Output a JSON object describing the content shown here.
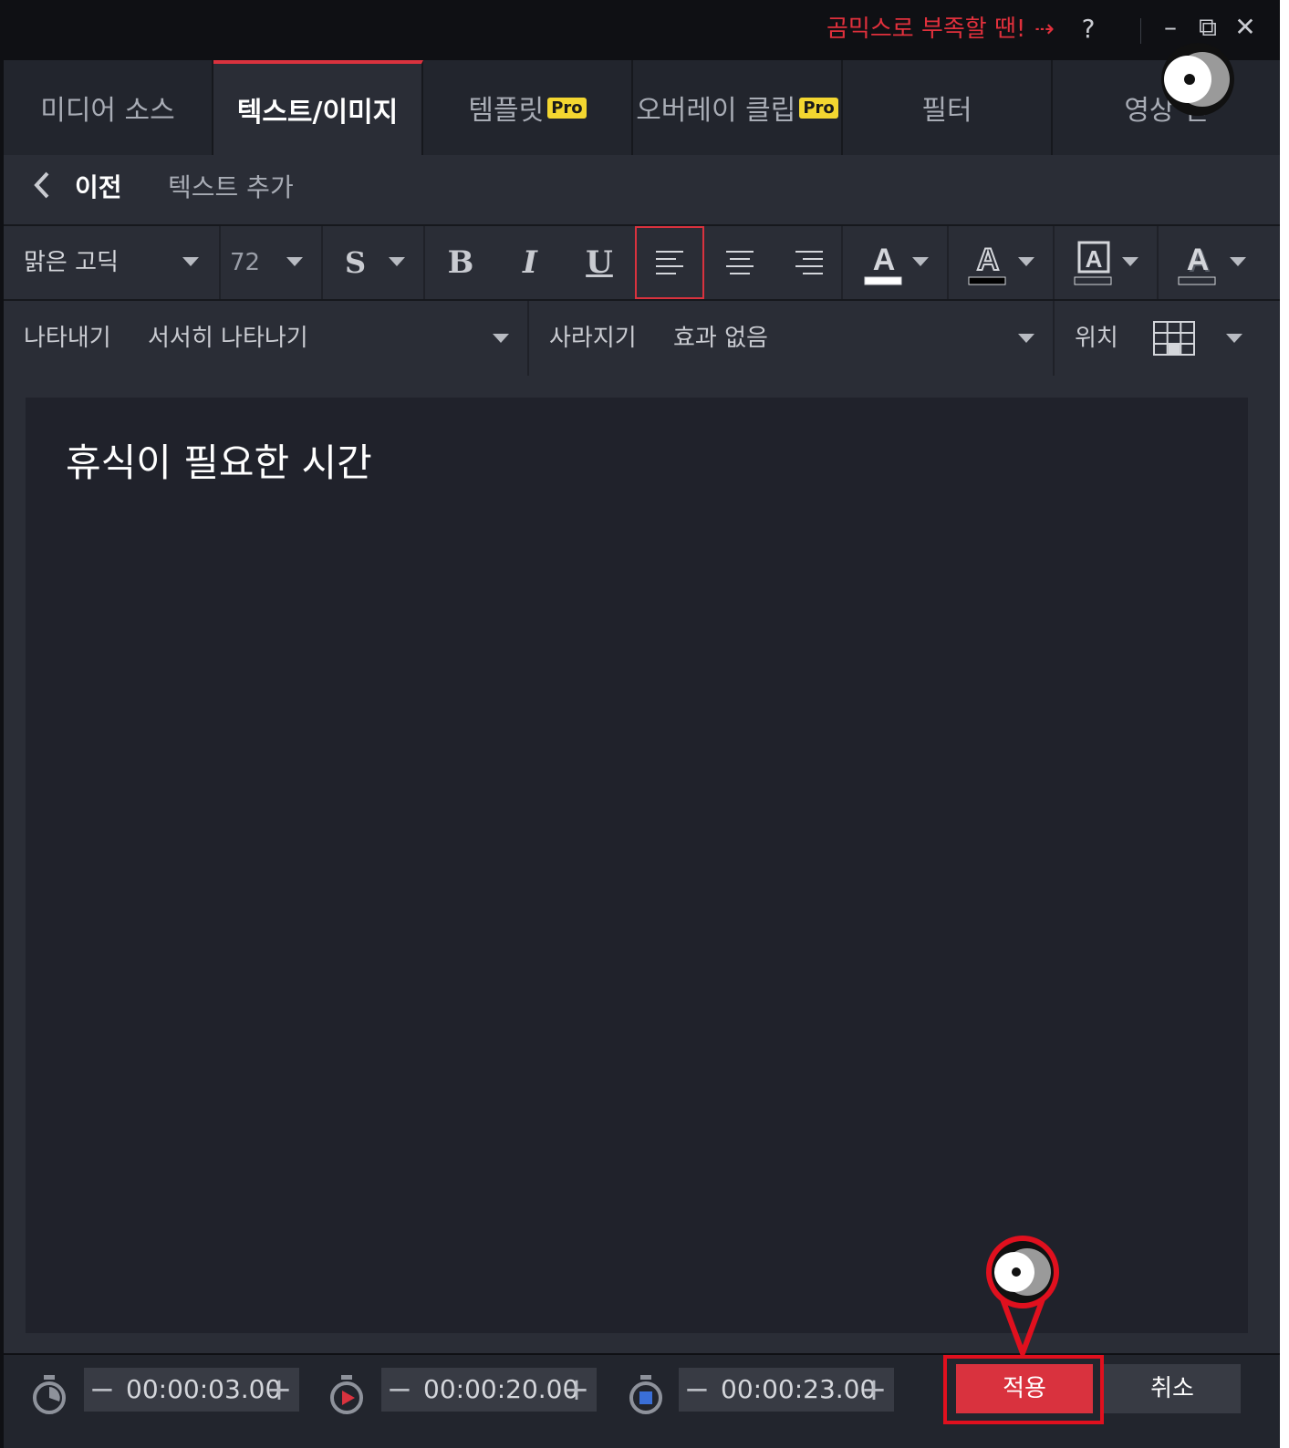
{
  "titlebar": {
    "promo_text": "곰믹스로 부족할 땐!",
    "promo_arrow": "⇢",
    "help_label": "?",
    "minimize_label": "–",
    "restore_label": "⧉",
    "close_label": "✕"
  },
  "tabs": [
    {
      "label": "미디어 소스",
      "pro": ""
    },
    {
      "label": "텍스트/이미지",
      "pro": ""
    },
    {
      "label": "템플릿",
      "pro": "Pro"
    },
    {
      "label": "오버레이 클립",
      "pro": "Pro"
    },
    {
      "label": "필터",
      "pro": ""
    },
    {
      "label": "영상 전",
      "pro": ""
    }
  ],
  "subhead": {
    "back_label": "이전",
    "title": "텍스트 추가"
  },
  "toolbar": {
    "font_name": "맑은 고딕",
    "font_size": "72",
    "strike_label": "S",
    "bold_label": "B",
    "italic_label": "I",
    "underline_label": "U",
    "selected_alignment": "left",
    "text_color": "#ffffff",
    "outline_color": "#000000",
    "background_color": "#2a2d36",
    "shadow_color": "#2a2d36",
    "color_glyph": "A"
  },
  "effects": {
    "appear_label": "나타내기",
    "appear_value": "서서히 나타나기",
    "disappear_label": "사라지기",
    "disappear_value": "효과 없음",
    "position_label": "위치"
  },
  "editor": {
    "text": "휴식이 필요한 시간"
  },
  "footer": {
    "minus": "−",
    "plus": "+",
    "start_time": "00:00:03.00",
    "duration_time": "00:00:20.00",
    "end_time": "00:00:23.00",
    "apply_label": "적용",
    "cancel_label": "취소"
  },
  "colors": {
    "accent": "#d9323e",
    "pro_badge": "#f3d630",
    "panel": "#2a2d36",
    "editor_bg": "#20222b"
  }
}
